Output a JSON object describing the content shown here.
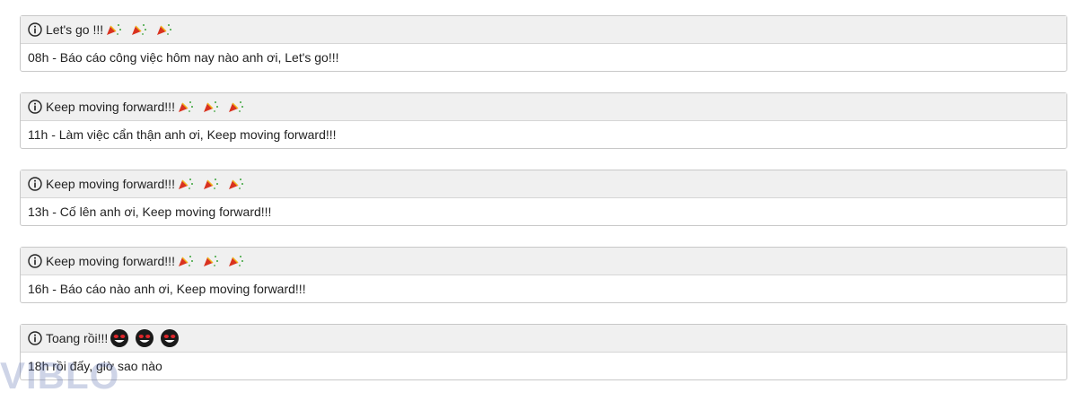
{
  "notifications": [
    {
      "title": "Let's go !!!",
      "emoji": "party-popper-icon",
      "emoji_count": 3,
      "body": "08h - Báo cáo công việc hôm nay nào anh ơi, Let's go!!!"
    },
    {
      "title": "Keep moving forward!!!",
      "emoji": "party-popper-icon",
      "emoji_count": 3,
      "body": "11h - Làm việc cẩn thận anh ơi, Keep moving forward!!!"
    },
    {
      "title": "Keep moving forward!!!",
      "emoji": "party-popper-icon",
      "emoji_count": 3,
      "body": "13h - Cố lên anh ơi, Keep moving forward!!!"
    },
    {
      "title": "Keep moving forward!!!",
      "emoji": "party-popper-icon",
      "emoji_count": 3,
      "body": "16h - Báo cáo nào anh ơi, Keep moving forward!!!"
    },
    {
      "title": "Toang rồi!!!",
      "emoji": "devil-face-icon",
      "emoji_count": 3,
      "body": "18h rồi đấy, giờ sao nào"
    }
  ],
  "watermark": "VIBLO",
  "colors": {
    "header_bg": "#f0f0f0",
    "border": "#c8c8c8",
    "party_red": "#d9321f",
    "party_green": "#3aa33a",
    "devil_red": "#e0262a"
  }
}
